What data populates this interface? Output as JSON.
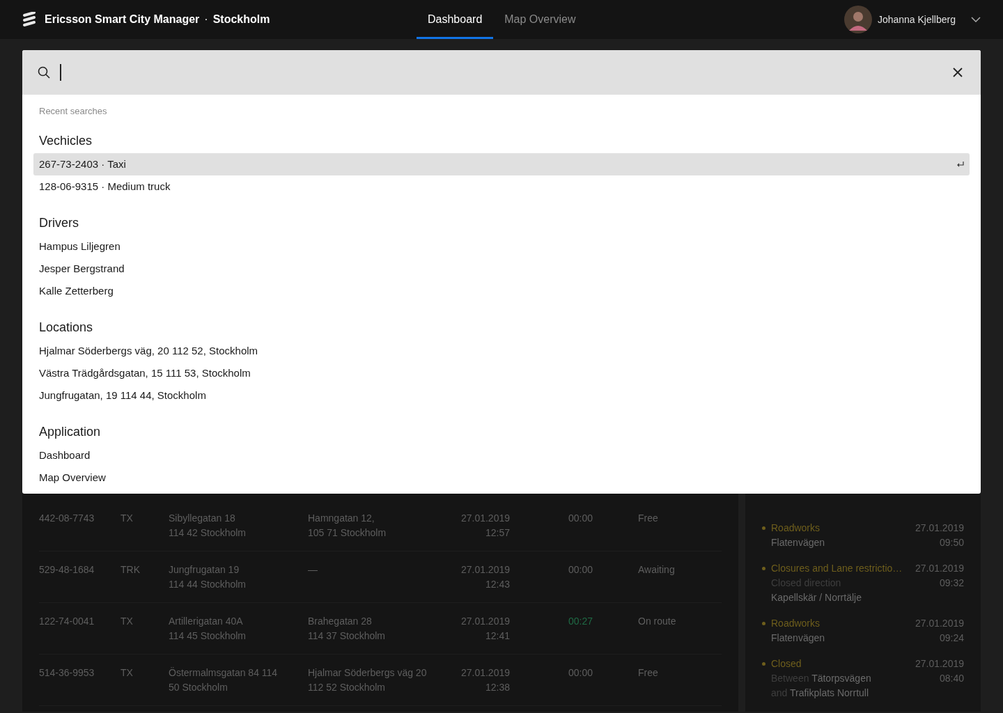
{
  "header": {
    "title": "Ericsson Smart City Manager",
    "separator": "·",
    "city": "Stockholm",
    "user": "Johanna Kjellberg"
  },
  "tabs": [
    {
      "label": "Dashboard",
      "selected": true
    },
    {
      "label": "Map Overview",
      "selected": false
    }
  ],
  "search": {
    "recent_label": "Recent searches",
    "groups": [
      {
        "title": "Vechicles",
        "items": [
          {
            "label": "267-73-2403 · Taxi",
            "selected": true
          },
          {
            "label": "128-06-9315 · Medium truck",
            "selected": false
          }
        ]
      },
      {
        "title": "Drivers",
        "items": [
          {
            "label": "Hampus Liljegren",
            "selected": false
          },
          {
            "label": "Jesper Bergstrand",
            "selected": false
          },
          {
            "label": "Kalle Zetterberg",
            "selected": false
          }
        ]
      },
      {
        "title": "Locations",
        "items": [
          {
            "label": "Hjalmar Söderbergs väg, 20 112 52, Stockholm",
            "selected": false
          },
          {
            "label": "Västra Trädgårdsgatan, 15 111 53, Stockholm",
            "selected": false
          },
          {
            "label": "Jungfrugatan, 19 114 44, Stockholm",
            "selected": false
          }
        ]
      },
      {
        "title": "Application",
        "items": [
          {
            "label": "Dashboard",
            "selected": false
          },
          {
            "label": "Map Overview",
            "selected": false
          }
        ]
      }
    ]
  },
  "table": {
    "rows": [
      {
        "id": "442-08-7743",
        "type": "TX",
        "from": [
          "Sibyllegatan 18",
          "114 42 Stockholm"
        ],
        "to": [
          "Hamngatan 12,",
          "105 71 Stockholm"
        ],
        "date": "27.01.2019",
        "time": "12:57",
        "eta": "00:00",
        "eta_active": false,
        "status": "Free"
      },
      {
        "id": "529-48-1684",
        "type": "TRK",
        "from": [
          "Jungfrugatan 19",
          "114 44 Stockholm"
        ],
        "to": [
          "—"
        ],
        "date": "27.01.2019",
        "time": "12:43",
        "eta": "00:00",
        "eta_active": false,
        "status": "Awaiting"
      },
      {
        "id": "122-74-0041",
        "type": "TX",
        "from": [
          "Artillerigatan 40A",
          "114 45 Stockholm"
        ],
        "to": [
          "Brahegatan 28",
          "114 37 Stockholm"
        ],
        "date": "27.01.2019",
        "time": "12:41",
        "eta": "00:27",
        "eta_active": true,
        "status": "On route"
      },
      {
        "id": "514-36-9953",
        "type": "TX",
        "from": [
          "Östermalmsgatan 84 114",
          "50 Stockholm"
        ],
        "to": [
          "Hjalmar Söderbergs väg 20",
          "112 52 Stockholm"
        ],
        "date": "27.01.2019",
        "time": "12:38",
        "eta": "00:00",
        "eta_active": false,
        "status": "Free"
      }
    ]
  },
  "incidents": [
    {
      "title": "Roadworks",
      "color": "#6e5e1c",
      "detail": [
        {
          "text": "Flatenvägen",
          "dim": false
        }
      ],
      "date": "27.01.2019",
      "time": "09:50"
    },
    {
      "title": "Closures and Lane restrictio…",
      "color": "#6e5e1c",
      "detail": [
        {
          "text": "Closed direction",
          "dim": true
        },
        {
          "text": "Kapellskär / Norrtälje",
          "dim": false
        }
      ],
      "date": "27.01.2019",
      "time": "09:32"
    },
    {
      "title": "Roadworks",
      "color": "#6e5e1c",
      "detail": [
        {
          "text": "Flatenvägen",
          "dim": false
        }
      ],
      "date": "27.01.2019",
      "time": "09:24"
    },
    {
      "title": "Closed",
      "color": "#6e5e1c",
      "detail": [
        {
          "text": "Between",
          "dim": true
        },
        {
          "text": "Tätorpsvägen",
          "dim": false
        },
        {
          "text": "and",
          "dim": true
        },
        {
          "text": "Trafikplats Norrtull",
          "dim": false
        }
      ],
      "date": "27.01.2019",
      "time": "08:40"
    }
  ]
}
